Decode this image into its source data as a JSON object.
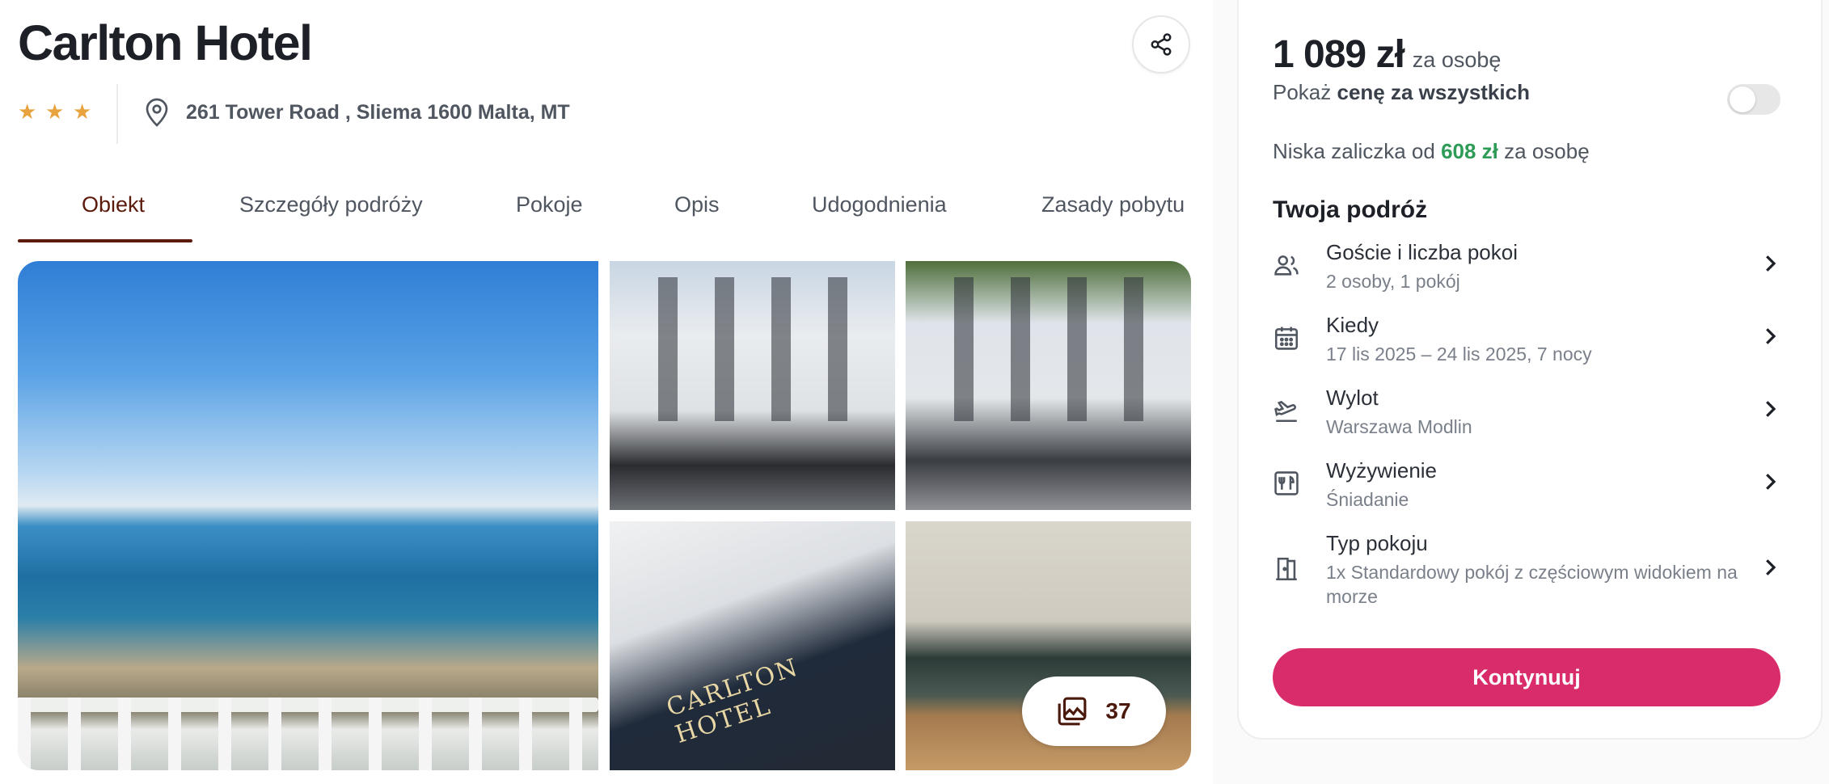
{
  "hotel": {
    "name": "Carlton Hotel",
    "stars": 3,
    "address": "261 Tower Road , Sliema 1600 Malta, MT"
  },
  "tabs": [
    {
      "label": "Obiekt",
      "active": true
    },
    {
      "label": "Szczegóły podróży",
      "active": false
    },
    {
      "label": "Pokoje",
      "active": false
    },
    {
      "label": "Opis",
      "active": false
    },
    {
      "label": "Udogodnienia",
      "active": false
    },
    {
      "label": "Zasady pobytu",
      "active": false
    }
  ],
  "gallery": {
    "photo_count": "37",
    "sign_text": "CARLTON HOTEL"
  },
  "booking": {
    "price": "1 089 zł",
    "price_suffix": "za osobę",
    "show_all_prefix": "Pokaż ",
    "show_all_bold": "cenę za wszystkich",
    "show_all_enabled": false,
    "deposit_prefix": "Niska zaliczka od ",
    "deposit_amount": "608 zł",
    "deposit_suffix": " za osobę",
    "trip_title": "Twoja podróż",
    "rows": [
      {
        "label": "Goście i liczba pokoi",
        "value": "2 osoby, 1 pokój",
        "icon": "guests-icon"
      },
      {
        "label": "Kiedy",
        "value": "17 lis 2025 – 24 lis 2025, 7 nocy",
        "icon": "calendar-icon"
      },
      {
        "label": "Wylot",
        "value": "Warszawa Modlin",
        "icon": "plane-departure-icon"
      },
      {
        "label": "Wyżywienie",
        "value": "Śniadanie",
        "icon": "meal-icon"
      },
      {
        "label": "Typ pokoju",
        "value": "1x Standardowy pokój z częściowym widokiem na morze",
        "icon": "door-icon"
      }
    ],
    "cta_label": "Kontynuuj"
  },
  "colors": {
    "accent_brown": "#5b1a0b",
    "star": "#e8a23e",
    "deposit_green": "#2e9b57",
    "cta_pink": "#d92c6b"
  }
}
